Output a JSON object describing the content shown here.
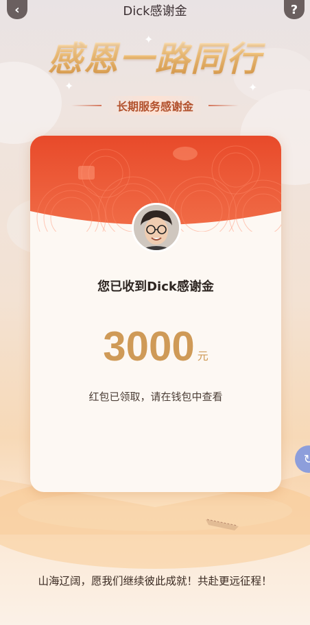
{
  "header": {
    "title": "Dick感谢金",
    "back_icon": "chevron-left-icon",
    "help_icon": "question-icon"
  },
  "hero": {
    "title": "感恩一路同行",
    "subtitle": "长期服务感谢金"
  },
  "card": {
    "received_text": "您已收到Dick感谢金",
    "amount": "3000",
    "unit": "元",
    "claimed_text": "红包已领取，请在钱包中查看",
    "colors": {
      "header_red": "#e8452b",
      "amount_gold": "#cf9a57"
    }
  },
  "footer": {
    "message": "山海辽阔，愿我们继续彼此成就！共赴更远征程！"
  },
  "side_button": {
    "icon": "share-icon"
  }
}
